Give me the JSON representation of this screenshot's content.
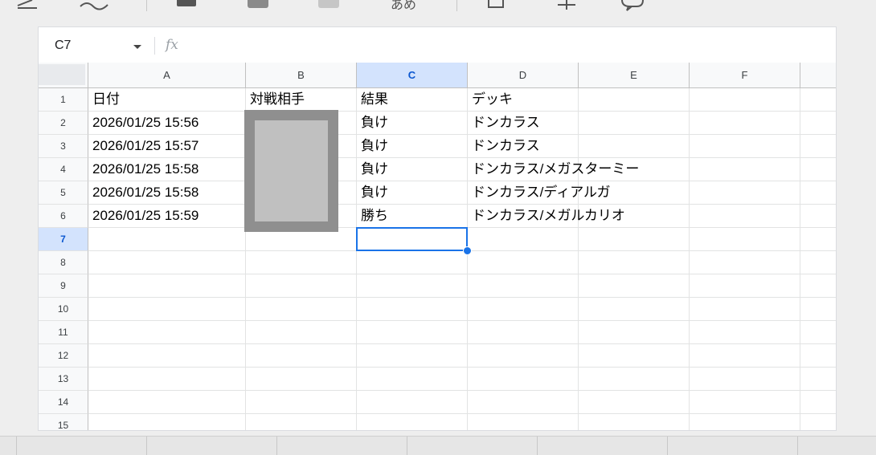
{
  "name_box": {
    "value": "C7"
  },
  "formula_bar": {
    "label": "fx",
    "value": ""
  },
  "toolbar": {
    "text_glyph": "あめ"
  },
  "columns": [
    "A",
    "B",
    "C",
    "D",
    "E",
    "F"
  ],
  "selected": {
    "column": "C",
    "row": "7"
  },
  "rows": [
    {
      "num": "1",
      "cells": [
        "日付",
        "対戦相手",
        "結果",
        "デッキ",
        "",
        ""
      ]
    },
    {
      "num": "2",
      "cells": [
        "2026/01/25 15:56",
        "",
        "負け",
        "ドンカラス",
        "",
        ""
      ]
    },
    {
      "num": "3",
      "cells": [
        "2026/01/25 15:57",
        "",
        "負け",
        "ドンカラス",
        "",
        ""
      ]
    },
    {
      "num": "4",
      "cells": [
        "2026/01/25 15:58",
        "",
        "負け",
        "ドンカラス/メガスターミー",
        "",
        ""
      ]
    },
    {
      "num": "5",
      "cells": [
        "2026/01/25 15:58",
        "",
        "負け",
        "ドンカラス/ディアルガ",
        "",
        ""
      ]
    },
    {
      "num": "6",
      "cells": [
        "2026/01/25 15:59",
        "",
        "勝ち",
        "ドンカラス/メガルカリオ",
        "",
        ""
      ]
    },
    {
      "num": "7",
      "cells": [
        "",
        "",
        "",
        "",
        "",
        ""
      ]
    },
    {
      "num": "8",
      "cells": [
        "",
        "",
        "",
        "",
        "",
        ""
      ]
    },
    {
      "num": "9",
      "cells": [
        "",
        "",
        "",
        "",
        "",
        ""
      ]
    },
    {
      "num": "10",
      "cells": [
        "",
        "",
        "",
        "",
        "",
        ""
      ]
    },
    {
      "num": "11",
      "cells": [
        "",
        "",
        "",
        "",
        "",
        ""
      ]
    },
    {
      "num": "12",
      "cells": [
        "",
        "",
        "",
        "",
        "",
        ""
      ]
    },
    {
      "num": "13",
      "cells": [
        "",
        "",
        "",
        "",
        "",
        ""
      ]
    },
    {
      "num": "14",
      "cells": [
        "",
        "",
        "",
        "",
        "",
        ""
      ]
    },
    {
      "num": "15",
      "cells": [
        "",
        "",
        "",
        "",
        "",
        ""
      ]
    }
  ],
  "colors": {
    "selection": "#1a73e8",
    "header_selected": "#d3e3fd",
    "redaction": "#8f8f8f"
  }
}
